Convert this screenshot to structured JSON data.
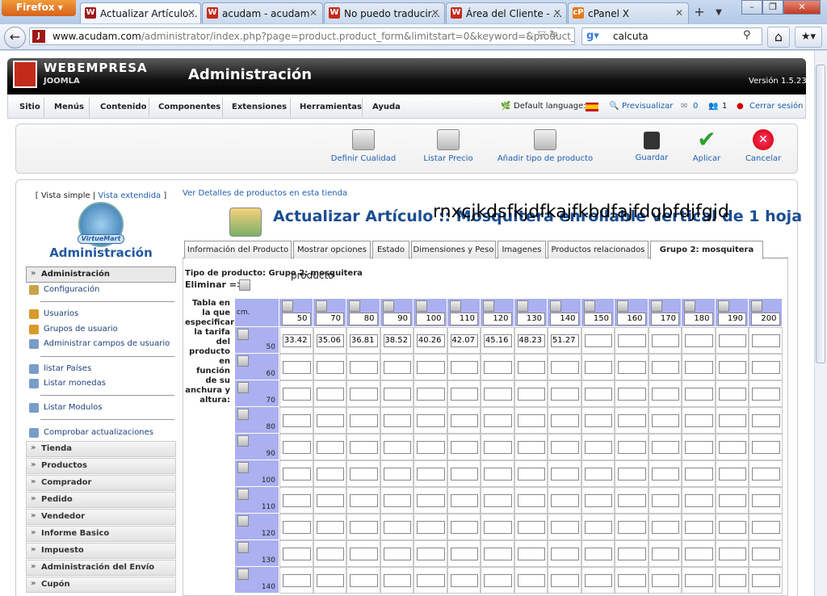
{
  "browser": {
    "menu_label": "Firefox ▾",
    "tabs": [
      {
        "label": "Actualizar Artículo...",
        "icon": "joomla-icon",
        "color": "#a01818"
      },
      {
        "label": "acudam - acudam",
        "icon": "webempresa-icon",
        "color": "#c42a1a"
      },
      {
        "label": "No puedo traducir...",
        "icon": "webempresa-icon",
        "color": "#c42a1a"
      },
      {
        "label": "Área del Cliente - ...",
        "icon": "webempresa-icon",
        "color": "#c42a1a"
      },
      {
        "label": "cPanel X",
        "icon": "cpanel-icon",
        "color": "#e47a16"
      }
    ],
    "url_host": "www.acudam.com",
    "url_path": "/administrator/index.php?page=product.product_form&limitstart=0&keyword=&product_i",
    "search_text": "calcuta"
  },
  "header": {
    "brand": "WEBEMPRESA",
    "brand_sub": "JOOMLA",
    "title": "Administración",
    "version": "Versión 1.5.23"
  },
  "menu": [
    "Sitio",
    "Menús",
    "Contenido",
    "Componentes",
    "Extensiones",
    "Herramientas",
    "Ayuda"
  ],
  "status": {
    "default_language": "Default language:",
    "preview": "Previsualizar",
    "messages": "0",
    "users": "1",
    "logout": "Cerrar sesión"
  },
  "toolbar": [
    {
      "label": "Definir Cualidad",
      "icon": "box-icon"
    },
    {
      "label": "Listar Precio",
      "icon": "box-icon"
    },
    {
      "label": "Añadir tipo de producto",
      "icon": "box-icon"
    },
    {
      "label": "Guardar",
      "icon": "floppy-icon"
    },
    {
      "label": "Aplicar",
      "icon": "checkmark-icon"
    },
    {
      "label": "Cancelar",
      "icon": "cancel-icon"
    }
  ],
  "sidebar": {
    "view_simple": "[ Vista simple",
    "view_sep": "|",
    "view_extended": "Vista extendida",
    "view_end": "]",
    "logo_text": "VirtueMart",
    "title": "Administración",
    "active": "Administración",
    "items": [
      {
        "label": "Configuración",
        "icon": "wrench-icon"
      },
      {
        "label": "Usuarios",
        "icon": "users-icon"
      },
      {
        "label": "Grupos de usuario",
        "icon": "users-icon"
      },
      {
        "label": "Administrar campos de usuario",
        "icon": "fields-icon"
      },
      {
        "label": "listar Países",
        "icon": "fields-icon"
      },
      {
        "label": "Listar monedas",
        "icon": "fields-icon"
      },
      {
        "label": "Listar Modulos",
        "icon": "fields-icon"
      },
      {
        "label": "Comprobar actualizaciones",
        "icon": "fields-icon"
      }
    ],
    "sections": [
      "Tienda",
      "Productos",
      "Comprador",
      "Pedido",
      "Vendedor",
      "Informe Basico",
      "Impuesto",
      "Administración del Envío",
      "Cupón"
    ]
  },
  "content": {
    "details_link": "Ver Detalles de productos en esta tienda",
    "page_title": "Actualizar Artículo :: Mosquitera enrollable vertical de 1 hoja",
    "overlay_title": "rnxcjkdsfkjdfkajfkbdfajfdqbfdjfgjd",
    "tabs": [
      "Información del Producto",
      "Mostrar opciones",
      "Estado",
      "Dimensiones y Peso",
      "Imagenes",
      "Productos relacionados",
      "Grupo 2: mosquitera"
    ],
    "tab_overlay": "producto",
    "product_type": "Tipo de producto: Grupo 2: mosquitera",
    "product_type_overlay": "producto",
    "delete_label": "Eliminar =>",
    "table_description": "Tabla en la que especificar la tarifa del producto en función de su anchura y altura:",
    "corner_label": "cm.",
    "widths": [
      "50",
      "70",
      "80",
      "90",
      "100",
      "110",
      "120",
      "130",
      "140",
      "150",
      "160",
      "170",
      "180",
      "190",
      "200"
    ],
    "heights": [
      "50",
      "60",
      "70",
      "80",
      "90",
      "100",
      "110",
      "120",
      "130",
      "140"
    ],
    "prices_row_50": [
      "33.42",
      "35.06",
      "36.81",
      "38.52",
      "40.26",
      "42.07",
      "45.16",
      "48.23",
      "51.27",
      "",
      "",
      "",
      "",
      "",
      ""
    ]
  }
}
